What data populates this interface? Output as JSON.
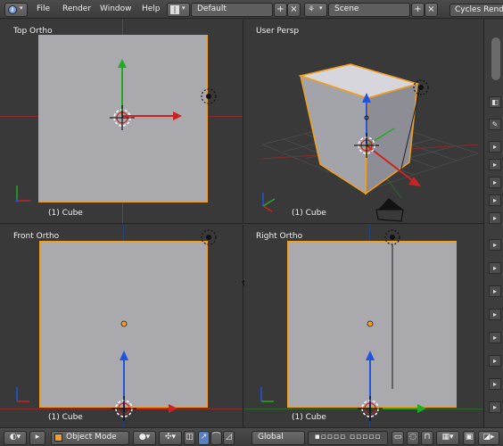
{
  "topbar": {
    "info_icon": "info-icon",
    "menus": [
      "File",
      "Render",
      "Window",
      "Help"
    ],
    "layout_field": "Default",
    "scene_field": "Scene",
    "engine": "Cycles Render",
    "add_symbol": "+",
    "close_symbol": "×"
  },
  "viewports": {
    "top_left": {
      "label": "Top Ortho",
      "object": "(1) Cube"
    },
    "top_right": {
      "label": "User Persp",
      "object": "(1) Cube"
    },
    "bottom_left": {
      "label": "Front Ortho",
      "object": "(1) Cube"
    },
    "bottom_right": {
      "label": "Right Ortho",
      "object": "(1) Cube"
    }
  },
  "bottombar": {
    "mode": "Object Mode",
    "orientation": "Global"
  },
  "colors": {
    "cube_fill": "#a9a9ae",
    "selection_outline": "#f29f1f",
    "axis_x": "#cc2222",
    "axis_y": "#22aa22",
    "axis_z": "#2255dd"
  }
}
